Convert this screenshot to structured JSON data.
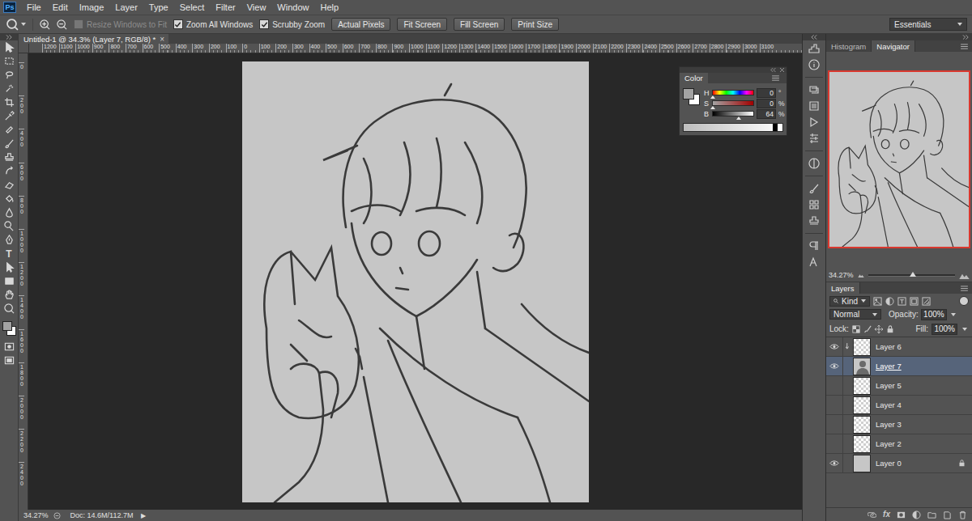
{
  "app": {
    "logo": "Ps"
  },
  "menu": [
    "File",
    "Edit",
    "Image",
    "Layer",
    "Type",
    "Select",
    "Filter",
    "View",
    "Window",
    "Help"
  ],
  "options_bar": {
    "checkboxes": [
      {
        "label": "Resize Windows to Fit",
        "checked": false,
        "disabled": true
      },
      {
        "label": "Zoom All Windows",
        "checked": true,
        "disabled": false
      },
      {
        "label": "Scrubby Zoom",
        "checked": true,
        "disabled": false
      }
    ],
    "buttons": [
      "Actual Pixels",
      "Fit Screen",
      "Fill Screen",
      "Print Size"
    ],
    "workspace": "Essentials"
  },
  "toolbar": {
    "type_glyph": "T"
  },
  "document_tab": {
    "title": "Untitled-1 @ 34.3% (Layer 7, RGB/8) *",
    "close": "×"
  },
  "rulers": {
    "horizontal": [
      "1200",
      "1100",
      "1000",
      "900",
      "800",
      "700",
      "600",
      "500",
      "400",
      "300",
      "200",
      "100",
      "0",
      "100",
      "200",
      "300",
      "400",
      "500",
      "600",
      "700",
      "800",
      "900",
      "1000",
      "1100",
      "1200",
      "1300",
      "1400",
      "1500",
      "1600",
      "1700",
      "1800",
      "1900",
      "2000",
      "2100",
      "2200",
      "2300",
      "2400",
      "2500",
      "2600",
      "2700",
      "2800",
      "2900",
      "3000",
      "3100"
    ],
    "vertical": [
      "0",
      "200",
      "400",
      "600",
      "800",
      "1000",
      "1200",
      "1400",
      "1600",
      "1800",
      "2000",
      "2200",
      "2400"
    ]
  },
  "color_panel": {
    "title": "Color",
    "channels": [
      {
        "name": "H",
        "value": "0",
        "unit": "°",
        "level": 0,
        "kind": "hue"
      },
      {
        "name": "S",
        "value": "0",
        "unit": "%",
        "level": 0,
        "kind": "saturation"
      },
      {
        "name": "B",
        "value": "64",
        "unit": "%",
        "level": 0.64,
        "kind": "brightness"
      }
    ]
  },
  "status_bar": {
    "zoom": "34.27%",
    "doc": "Doc: 14.6M/112.7M",
    "arrow": "▶"
  },
  "navigator": {
    "tabs": [
      {
        "label": "Histogram",
        "selected": false
      },
      {
        "label": "Navigator",
        "selected": true
      }
    ],
    "zoom": "34.27%",
    "level": 0.52
  },
  "layers_panel": {
    "title": "Layers",
    "filter": "Kind",
    "blend_mode": "Normal",
    "opacity_label": "Opacity:",
    "opacity": "100%",
    "lock_label": "Lock:",
    "fill_label": "Fill:",
    "fill": "100%",
    "fx_glyph": "fx",
    "layers": [
      {
        "name": "Layer 6",
        "visible": true,
        "selected": false,
        "clipped": true,
        "locked": false,
        "kind": "transparent"
      },
      {
        "name": "Layer 7",
        "visible": true,
        "selected": true,
        "clipped": false,
        "locked": false,
        "kind": "figure"
      },
      {
        "name": "Layer 5",
        "visible": false,
        "selected": false,
        "clipped": false,
        "locked": false,
        "kind": "transparent"
      },
      {
        "name": "Layer 4",
        "visible": false,
        "selected": false,
        "clipped": false,
        "locked": false,
        "kind": "transparent"
      },
      {
        "name": "Layer 3",
        "visible": false,
        "selected": false,
        "clipped": false,
        "locked": false,
        "kind": "transparent"
      },
      {
        "name": "Layer 2",
        "visible": false,
        "selected": false,
        "clipped": false,
        "locked": false,
        "kind": "transparent"
      },
      {
        "name": "Layer 0",
        "visible": true,
        "selected": false,
        "clipped": false,
        "locked": true,
        "kind": "fill"
      }
    ]
  }
}
